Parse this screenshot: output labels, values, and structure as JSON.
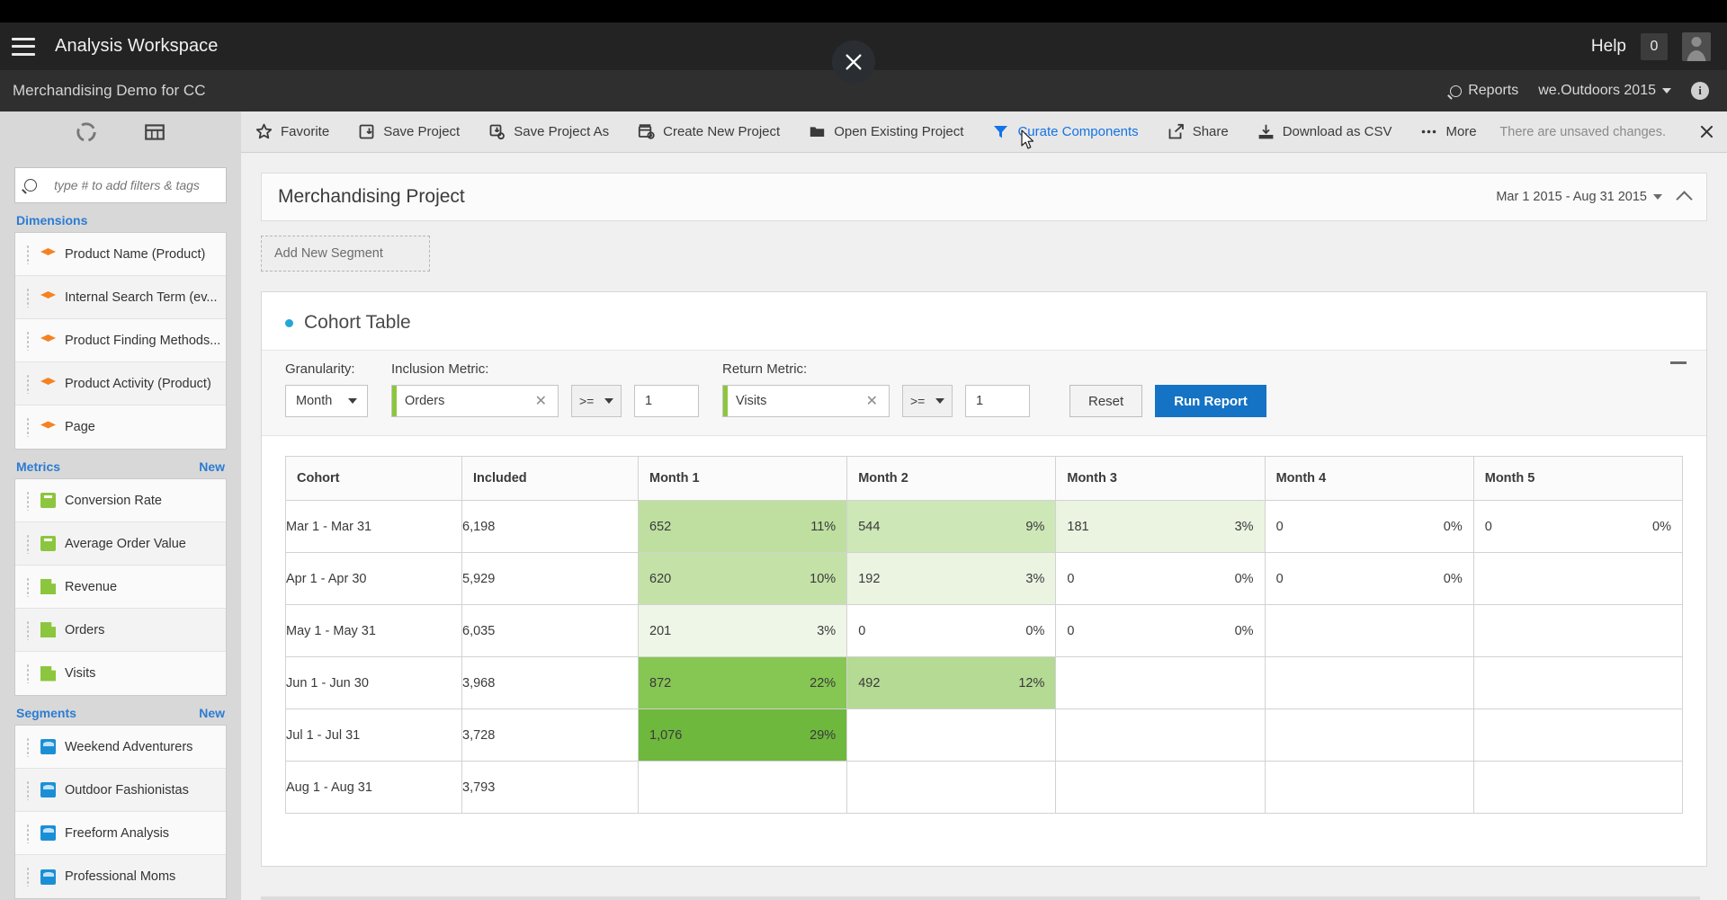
{
  "appbar": {
    "menu_icon": "hamburger-icon",
    "title": "Analysis Workspace",
    "help_label": "Help",
    "notification_count": "0",
    "avatar_icon": "user-avatar-icon"
  },
  "subbar": {
    "title": "Merchandising Demo for CC",
    "reports_label": "Reports",
    "report_suite": "we.Outdoors 2015",
    "info_icon": "info-icon"
  },
  "overlay": {
    "close_icon": "close-icon"
  },
  "left_rail": {
    "tabs": [
      {
        "name": "components-tab",
        "icon": "components-donut-icon"
      },
      {
        "name": "panels-tab",
        "icon": "table-panel-icon"
      }
    ],
    "search": {
      "placeholder": "type # to add filters & tags",
      "value": "",
      "icon": "search-icon"
    },
    "sections": [
      {
        "title": "Dimensions",
        "new_label": "",
        "icon_kind": "dimension",
        "items": [
          "Product Name (Product)",
          "Internal Search Term (ev...",
          "Product Finding Methods...",
          "Product Activity (Product)",
          "Page"
        ]
      },
      {
        "title": "Metrics",
        "new_label": "New",
        "icon_kind": "metric",
        "items": [
          "Conversion Rate",
          "Average Order Value",
          "Revenue",
          "Orders",
          "Visits"
        ]
      },
      {
        "title": "Segments",
        "new_label": "New",
        "icon_kind": "segment",
        "items": [
          "Weekend Adventurers",
          "Outdoor Fashionistas",
          "Freeform Analysis",
          "Professional Moms"
        ]
      }
    ]
  },
  "toolbar": {
    "items": [
      {
        "label": "Favorite",
        "icon": "star-icon",
        "active": false
      },
      {
        "label": "Save Project",
        "icon": "save-icon",
        "active": false
      },
      {
        "label": "Save Project As",
        "icon": "save-as-icon",
        "active": false
      },
      {
        "label": "Create New Project",
        "icon": "new-project-icon",
        "active": false
      },
      {
        "label": "Open Existing Project",
        "icon": "folder-icon",
        "active": false
      },
      {
        "label": "Curate Components",
        "icon": "filter-icon",
        "active": true
      },
      {
        "label": "Share",
        "icon": "share-icon",
        "active": false
      },
      {
        "label": "Download as CSV",
        "icon": "download-icon",
        "active": false
      },
      {
        "label": "More",
        "icon": "ellipsis-icon",
        "active": false
      }
    ],
    "status": "There are unsaved changes.",
    "close_icon": "close-icon",
    "accent_color": "#1473e6"
  },
  "project": {
    "title": "Merchandising Project",
    "date_range": "Mar 1 2015 - Aug 31 2015",
    "add_segment_label": "Add New Segment"
  },
  "panel": {
    "title": "Cohort Table",
    "controls": {
      "granularity_label": "Granularity:",
      "granularity_value": "Month",
      "inclusion_label": "Inclusion Metric:",
      "inclusion_metric": "Orders",
      "inclusion_operator": ">=",
      "inclusion_value": "1",
      "return_label": "Return Metric:",
      "return_metric": "Visits",
      "return_operator": ">=",
      "return_value": "1",
      "reset_label": "Reset",
      "run_label": "Run Report"
    }
  },
  "chart_data": {
    "type": "table",
    "title": "Cohort Table",
    "columns": [
      "Cohort",
      "Included",
      "Month 1",
      "Month 2",
      "Month 3",
      "Month 4",
      "Month 5"
    ],
    "rows": [
      {
        "cohort": "Mar 1 - Mar 31",
        "included": "6,198",
        "cells": [
          {
            "value": "652",
            "pct": "11%",
            "shade": "#bedfa0"
          },
          {
            "value": "544",
            "pct": "9%",
            "shade": "#cde7b7"
          },
          {
            "value": "181",
            "pct": "3%",
            "shade": "#eaf4e1"
          },
          {
            "value": "0",
            "pct": "0%",
            "shade": "#ffffff"
          },
          {
            "value": "0",
            "pct": "0%",
            "shade": "#ffffff"
          }
        ]
      },
      {
        "cohort": "Apr 1 - Apr 30",
        "included": "5,929",
        "cells": [
          {
            "value": "620",
            "pct": "10%",
            "shade": "#c4e2a8"
          },
          {
            "value": "192",
            "pct": "3%",
            "shade": "#eaf4e1"
          },
          {
            "value": "0",
            "pct": "0%",
            "shade": "#ffffff"
          },
          {
            "value": "0",
            "pct": "0%",
            "shade": "#ffffff"
          },
          {
            "value": "",
            "pct": "",
            "shade": ""
          }
        ]
      },
      {
        "cohort": "May 1 - May 31",
        "included": "6,035",
        "cells": [
          {
            "value": "201",
            "pct": "3%",
            "shade": "#eef6e7"
          },
          {
            "value": "0",
            "pct": "0%",
            "shade": "#ffffff"
          },
          {
            "value": "0",
            "pct": "0%",
            "shade": "#ffffff"
          },
          {
            "value": "",
            "pct": "",
            "shade": ""
          },
          {
            "value": "",
            "pct": "",
            "shade": ""
          }
        ]
      },
      {
        "cohort": "Jun 1 - Jun 30",
        "included": "3,968",
        "cells": [
          {
            "value": "872",
            "pct": "22%",
            "shade": "#86c653"
          },
          {
            "value": "492",
            "pct": "12%",
            "shade": "#b4da93"
          },
          {
            "value": "",
            "pct": "",
            "shade": ""
          },
          {
            "value": "",
            "pct": "",
            "shade": ""
          },
          {
            "value": "",
            "pct": "",
            "shade": ""
          }
        ]
      },
      {
        "cohort": "Jul 1 - Jul 31",
        "included": "3,728",
        "cells": [
          {
            "value": "1,076",
            "pct": "29%",
            "shade": "#6eb83e"
          },
          {
            "value": "",
            "pct": "",
            "shade": ""
          },
          {
            "value": "",
            "pct": "",
            "shade": ""
          },
          {
            "value": "",
            "pct": "",
            "shade": ""
          },
          {
            "value": "",
            "pct": "",
            "shade": ""
          }
        ]
      },
      {
        "cohort": "Aug 1 - Aug 31",
        "included": "3,793",
        "cells": [
          {
            "value": "",
            "pct": "",
            "shade": ""
          },
          {
            "value": "",
            "pct": "",
            "shade": ""
          },
          {
            "value": "",
            "pct": "",
            "shade": ""
          },
          {
            "value": "",
            "pct": "",
            "shade": ""
          },
          {
            "value": "",
            "pct": "",
            "shade": ""
          }
        ]
      }
    ]
  }
}
